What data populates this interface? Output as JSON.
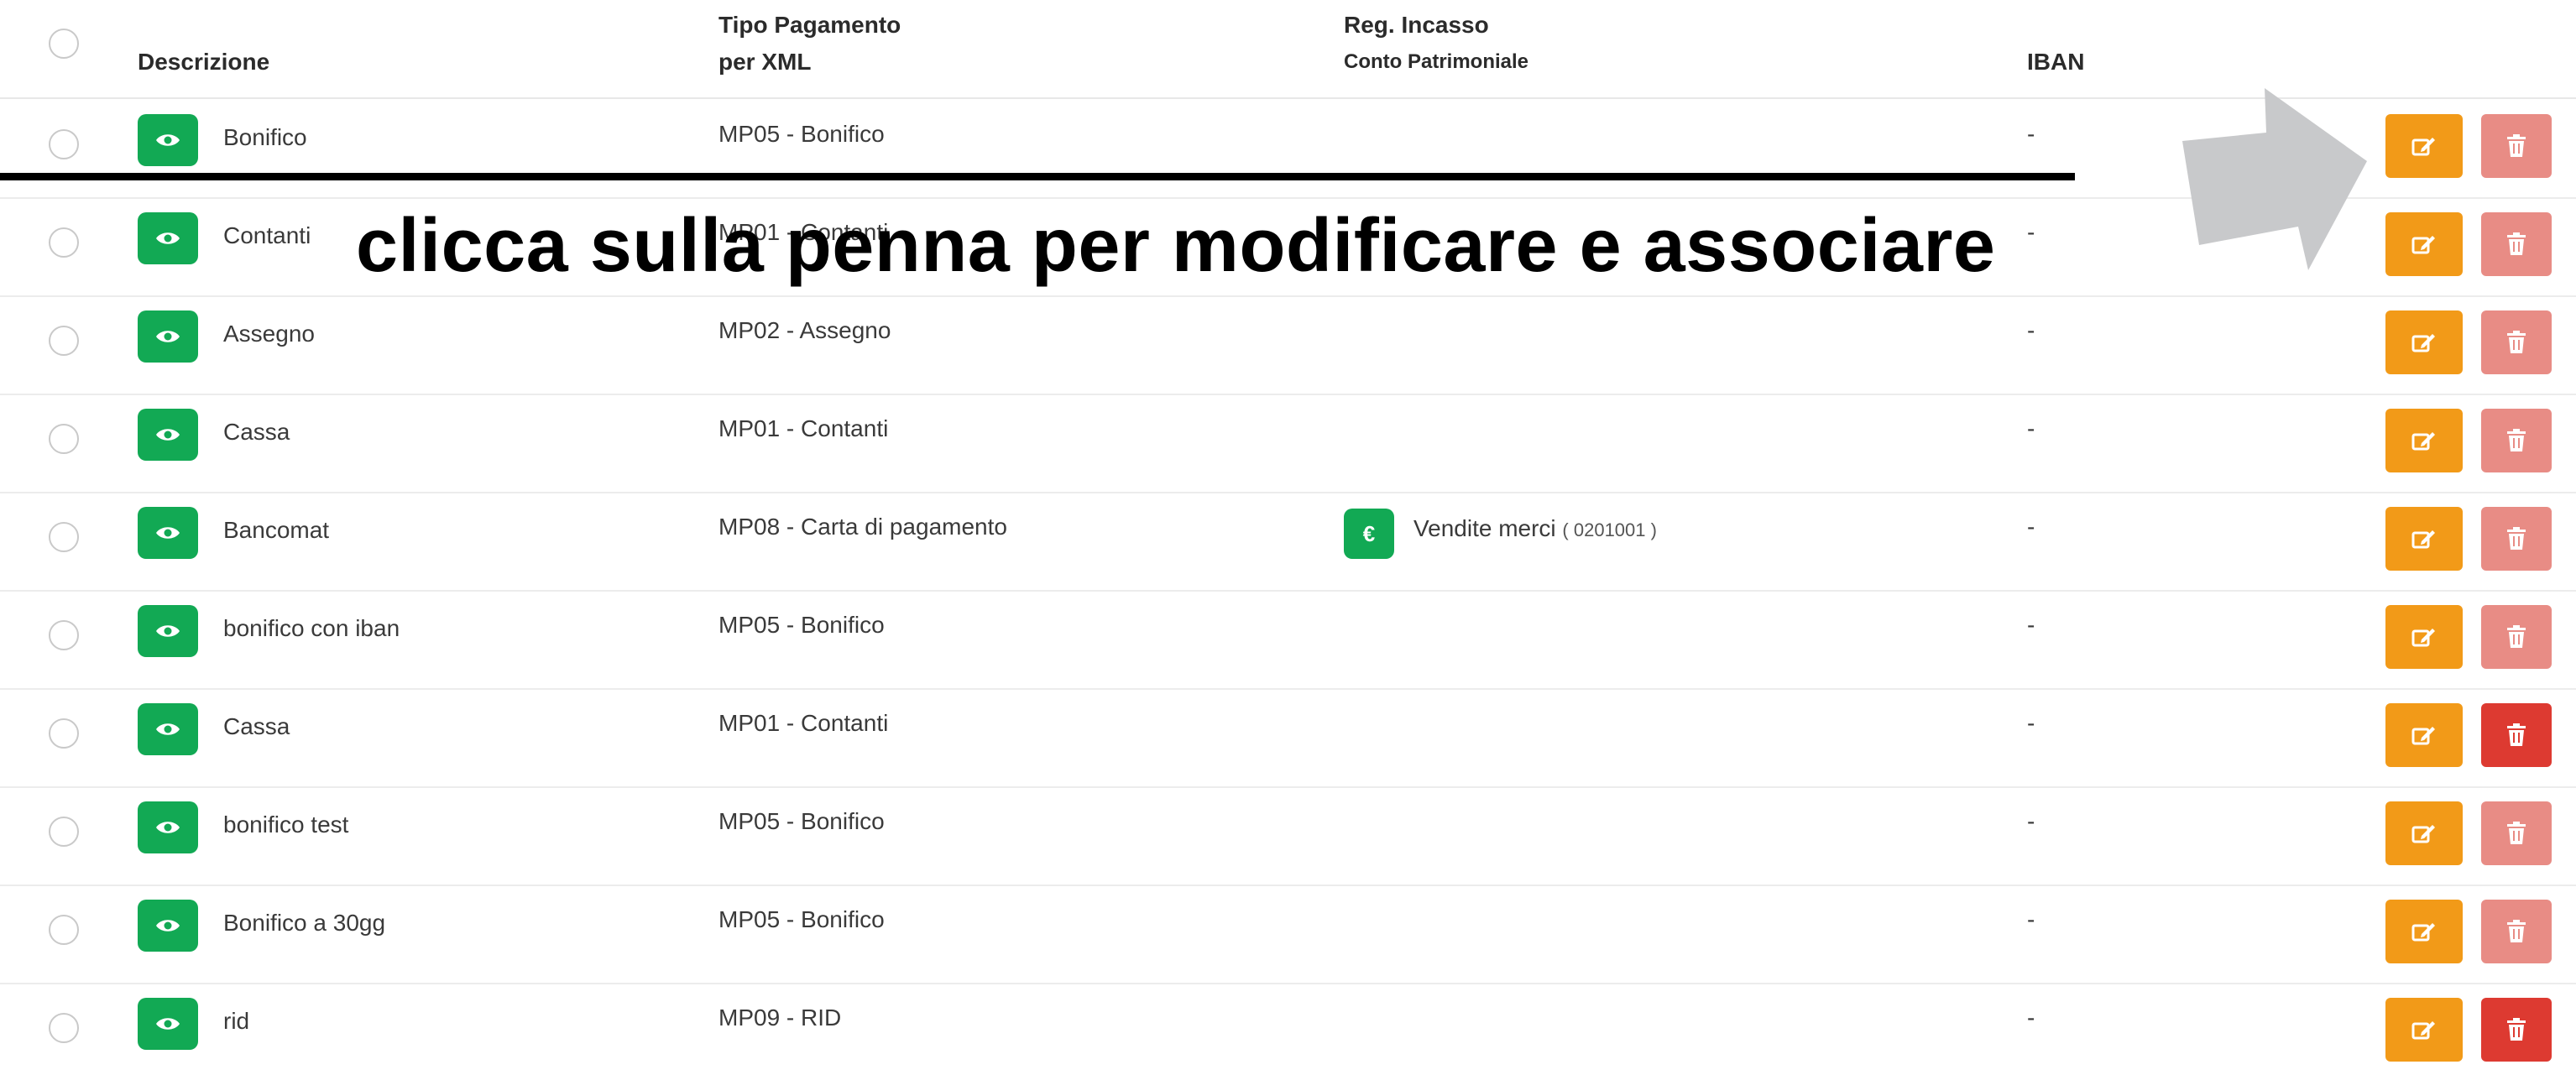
{
  "table": {
    "headers": {
      "descrizione": "Descrizione",
      "tipo_line1": "Tipo Pagamento",
      "tipo_line2": "per XML",
      "reg_line1": "Reg. Incasso",
      "reg_line2": "Conto Patrimoniale",
      "iban": "IBAN"
    },
    "rows": [
      {
        "descrizione": "Bonifico",
        "tipo": "MP05 - Bonifico",
        "conto": "",
        "conto_code": "",
        "iban": "-",
        "delete_enabled": false
      },
      {
        "descrizione": "Contanti",
        "tipo": "MP01 - Contanti",
        "conto": "",
        "conto_code": "",
        "iban": "-",
        "delete_enabled": false
      },
      {
        "descrizione": "Assegno",
        "tipo": "MP02 - Assegno",
        "conto": "",
        "conto_code": "",
        "iban": "-",
        "delete_enabled": false
      },
      {
        "descrizione": "Cassa",
        "tipo": "MP01 - Contanti",
        "conto": "",
        "conto_code": "",
        "iban": "-",
        "delete_enabled": false
      },
      {
        "descrizione": "Bancomat",
        "tipo": "MP08 - Carta di pagamento",
        "conto": "Vendite merci",
        "conto_code": "( 0201001 )",
        "iban": "-",
        "delete_enabled": false
      },
      {
        "descrizione": "bonifico con iban",
        "tipo": "MP05 - Bonifico",
        "conto": "",
        "conto_code": "",
        "iban": "-",
        "delete_enabled": false
      },
      {
        "descrizione": "Cassa",
        "tipo": "MP01 - Contanti",
        "conto": "",
        "conto_code": "",
        "iban": "-",
        "delete_enabled": true
      },
      {
        "descrizione": "bonifico test",
        "tipo": "MP05 - Bonifico",
        "conto": "",
        "conto_code": "",
        "iban": "-",
        "delete_enabled": false
      },
      {
        "descrizione": "Bonifico a 30gg",
        "tipo": "MP05 - Bonifico",
        "conto": "",
        "conto_code": "",
        "iban": "-",
        "delete_enabled": false
      },
      {
        "descrizione": "rid",
        "tipo": "MP09 - RID",
        "conto": "",
        "conto_code": "",
        "iban": "-",
        "delete_enabled": true
      }
    ]
  },
  "annotation": {
    "text": "clicca sulla penna per modificare e associare"
  },
  "icons": {
    "view": "eye-icon",
    "edit": "pencil-square-icon",
    "delete": "trash-icon",
    "conto": "euro-icon",
    "pointer": "arrow-icon"
  },
  "colors": {
    "view_button": "#12a954",
    "edit_button": "#f29a18",
    "delete_enabled": "#dd3a31",
    "delete_disabled": "#e88c85",
    "arrow": "#c8c9cb"
  },
  "euro_symbol": "€"
}
